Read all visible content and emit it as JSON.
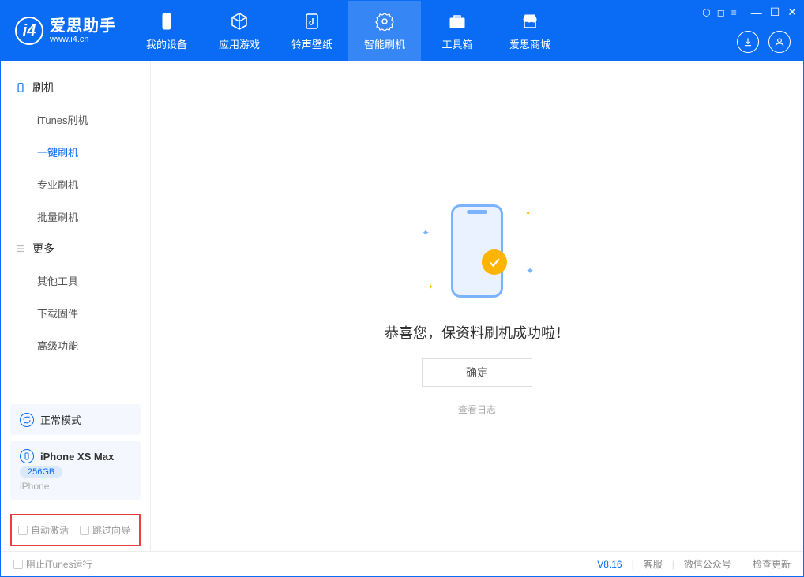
{
  "app": {
    "name": "爱思助手",
    "url": "www.i4.cn"
  },
  "tabs": [
    {
      "label": "我的设备"
    },
    {
      "label": "应用游戏"
    },
    {
      "label": "铃声壁纸"
    },
    {
      "label": "智能刷机"
    },
    {
      "label": "工具箱"
    },
    {
      "label": "爱思商城"
    }
  ],
  "sidebar": {
    "section1": "刷机",
    "items1": [
      "iTunes刷机",
      "一键刷机",
      "专业刷机",
      "批量刷机"
    ],
    "section2": "更多",
    "items2": [
      "其他工具",
      "下载固件",
      "高级功能"
    ]
  },
  "mode_panel": {
    "label": "正常模式"
  },
  "device": {
    "name": "iPhone XS Max",
    "storage": "256GB",
    "type": "iPhone"
  },
  "bottom_checks": {
    "auto_activate": "自动激活",
    "skip_guide": "跳过向导"
  },
  "main": {
    "success": "恭喜您，保资料刷机成功啦！",
    "ok": "确定",
    "view_log": "查看日志"
  },
  "status": {
    "block_itunes": "阻止iTunes运行",
    "version": "V8.16",
    "links": [
      "客服",
      "微信公众号",
      "检查更新"
    ]
  }
}
